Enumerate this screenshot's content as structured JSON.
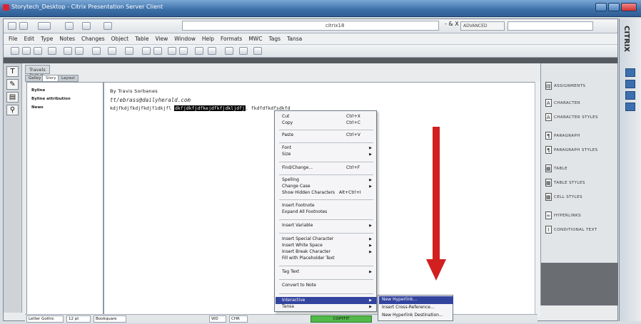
{
  "outer_window": {
    "title": "Storytech_Desktop - Citrix Presentation Server Client"
  },
  "toolbar": {
    "document_tab": "citrix18",
    "workspace_label": "ADVANCED",
    "window_controls": "- & X"
  },
  "menus": [
    "File",
    "Edit",
    "Type",
    "Notes",
    "Changes",
    "Object",
    "Table",
    "View",
    "Window",
    "Help",
    "Formats",
    "MWC",
    "Tags",
    "Tansa"
  ],
  "story_tabs": {
    "main_tab": "Travels Test",
    "sub_tabs": [
      "Galley",
      "Story",
      "Layout"
    ]
  },
  "styles_panel": [
    "Byline",
    "Byline attribution",
    "News"
  ],
  "story": {
    "line1": "By Travis Sorbanes",
    "line2": "tt/ebrass@dailyherald.com",
    "line3_before": "kdjfkdjfkdjfkdjf1dkjfl",
    "line3_selected": "dkfjdkfjdfkejdfkfjdkljdfj",
    "line3_after": ". fkdfdfkdfsdkfd"
  },
  "context_menu": [
    {
      "label": "Cut",
      "shortcut": "Ctrl+X"
    },
    {
      "label": "Copy",
      "shortcut": "Ctrl+C"
    },
    {
      "label": "Paste",
      "shortcut": "Ctrl+V"
    },
    {
      "label": "Font",
      "submenu": true
    },
    {
      "label": "Size",
      "submenu": true
    },
    {
      "label": "Find/Change...",
      "shortcut": "Ctrl+F"
    },
    {
      "label": "Spelling",
      "submenu": true
    },
    {
      "label": "Change Case",
      "submenu": true
    },
    {
      "label": "Show Hidden Characters",
      "shortcut": "Alt+Ctrl+I"
    },
    {
      "label": "Insert Footnote"
    },
    {
      "label": "Expand All Footnotes"
    },
    {
      "label": "Insert Variable",
      "submenu": true
    },
    {
      "label": "Insert Special Character",
      "submenu": true
    },
    {
      "label": "Insert White Space",
      "submenu": true
    },
    {
      "label": "Insert Break Character",
      "submenu": true
    },
    {
      "label": "Fill with Placeholder Text"
    },
    {
      "label": "Tag Text",
      "submenu": true
    },
    {
      "label": "Convert to Note"
    },
    {
      "label": "Interactive",
      "submenu": true
    },
    {
      "label": "Tansa",
      "submenu": true
    }
  ],
  "submenu": [
    "New Hyperlink...",
    "Insert Cross-Reference...",
    "New Hyperlink Destination..."
  ],
  "right_panel": [
    "Assignments",
    "Character",
    "Character Styles",
    "Paragraph",
    "Paragraph Styles",
    "Table",
    "Table Styles",
    "Cell Styles",
    "Hyperlinks",
    "Conditional Text"
  ],
  "statusbar": {
    "font": "Letter Gothic",
    "size": "12 pt",
    "font2": "Bookquare",
    "count1": "WD",
    "count2": "CHR",
    "status": "COPYFIT"
  },
  "annotation_arrow_color": "#d21f1f",
  "citrix_label": "CITRIX"
}
